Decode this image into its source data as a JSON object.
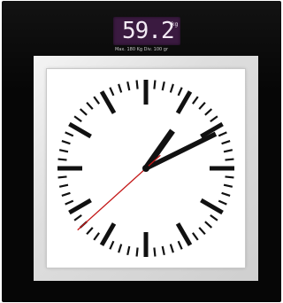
{
  "display": {
    "weight_value": "59.2",
    "weight_unit": "kg",
    "spec_text": "Max. 180 Kg  Div. 100 gr"
  },
  "clock": {
    "time": {
      "hour": 1,
      "minute": 10,
      "second": 38
    }
  },
  "colors": {
    "body": "#060606",
    "lcd_background": "#3a1a40",
    "lcd_text": "#f2eaf4",
    "face": "#ffffff",
    "ticks": "#111111",
    "hands": "#111111",
    "second_hand": "#c41818"
  }
}
